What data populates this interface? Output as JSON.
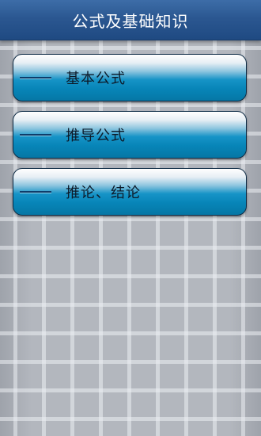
{
  "header": {
    "title": "公式及基础知识"
  },
  "menu": {
    "items": [
      {
        "label": "基本公式"
      },
      {
        "label": "推导公式"
      },
      {
        "label": "推论、结论"
      }
    ]
  },
  "colors": {
    "title_bar": "#2b5791",
    "button_blue": "#0785b8"
  }
}
